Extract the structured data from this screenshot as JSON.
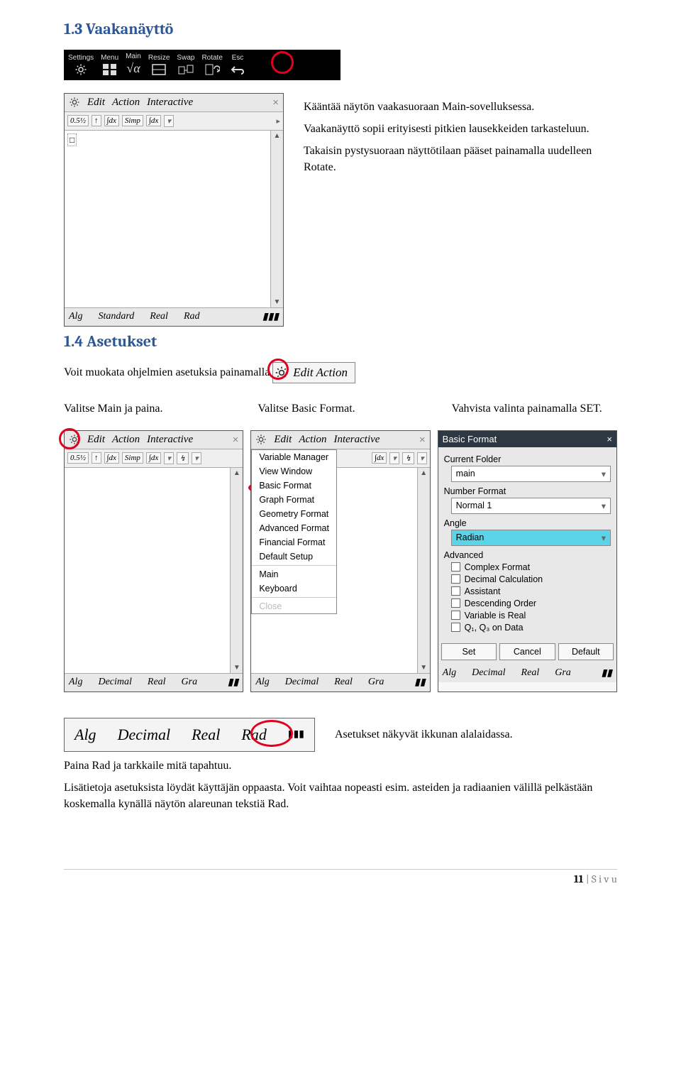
{
  "section1": {
    "heading": "1.3 Vaakanäyttö"
  },
  "menu_strip": {
    "items": [
      "Settings",
      "Menu",
      "Main",
      "Resize",
      "Swap",
      "Rotate",
      "Esc"
    ]
  },
  "calc1": {
    "menubar": [
      "Edit",
      "Action",
      "Interactive"
    ],
    "toolbar": [
      "0.5½",
      "↑",
      "∫dx",
      "Simp",
      "∫dx",
      "▾"
    ],
    "body_text": "□",
    "status": [
      "Alg",
      "Standard",
      "Real",
      "Rad"
    ]
  },
  "side_text": {
    "p1": "Kääntää näytön vaakasuoraan Main-sovelluksessa.",
    "p2": "Vaakanäyttö sopii erityisesti pitkien lausekkeiden tarkasteluun.",
    "p3": "Takaisin pystysuoraan näyttötilaan pääset painamalla uudelleen Rotate."
  },
  "section2": {
    "heading": "1.4 Asetukset"
  },
  "intro": {
    "line1": "Voit muokata ohjelmien asetuksia painamalla",
    "gear_label": "Edit  Action"
  },
  "captions": {
    "c1": "Valitse Main ja paina.",
    "c2": "Valitse Basic Format.",
    "c3": "Vahvista valinta painamalla SET."
  },
  "shot_a": {
    "menubar": [
      "Edit",
      "Action",
      "Interactive"
    ],
    "toolbar": [
      "0.5½",
      "↑",
      "∫dx",
      "Simp",
      "∫dx",
      "▾",
      "↯",
      "▾"
    ],
    "status": [
      "Alg",
      "Decimal",
      "Real",
      "Gra"
    ]
  },
  "shot_b": {
    "menubar": [
      "Edit",
      "Action",
      "Interactive"
    ],
    "dropdown": [
      "Variable Manager",
      "View Window",
      "Basic Format",
      "Graph Format",
      "Geometry Format",
      "Advanced Format",
      "Financial Format",
      "Default Setup",
      "Main",
      "Keyboard",
      "Close"
    ],
    "status": [
      "Alg",
      "Decimal",
      "Real",
      "Gra"
    ]
  },
  "dialog": {
    "title": "Basic Format",
    "current_folder_label": "Current Folder",
    "current_folder_value": "main",
    "number_format_label": "Number Format",
    "number_format_value": "Normal 1",
    "angle_label": "Angle",
    "angle_value": "Radian",
    "advanced_label": "Advanced",
    "checks": [
      "Complex Format",
      "Decimal Calculation",
      "Assistant",
      "Descending Order",
      "Variable is Real",
      "Q₁, Q₃ on Data"
    ],
    "buttons": [
      "Set",
      "Cancel",
      "Default"
    ],
    "status": [
      "Alg",
      "Decimal",
      "Real",
      "Gra"
    ]
  },
  "status_strip": [
    "Alg",
    "Decimal",
    "Real",
    "Rad"
  ],
  "side_right_text": "Asetukset näkyvät ikkunan alalaidassa.",
  "closing": {
    "p1": "Paina Rad ja tarkkaile mitä tapahtuu.",
    "p2": "Lisätietoja asetuksista löydät käyttäjän oppaasta. Voit vaihtaa nopeasti esim. asteiden ja radiaanien välillä pelkästään koskemalla kynällä näytön alareunan tekstiä Rad."
  },
  "page": {
    "num": "11",
    "label": "S i v u"
  }
}
